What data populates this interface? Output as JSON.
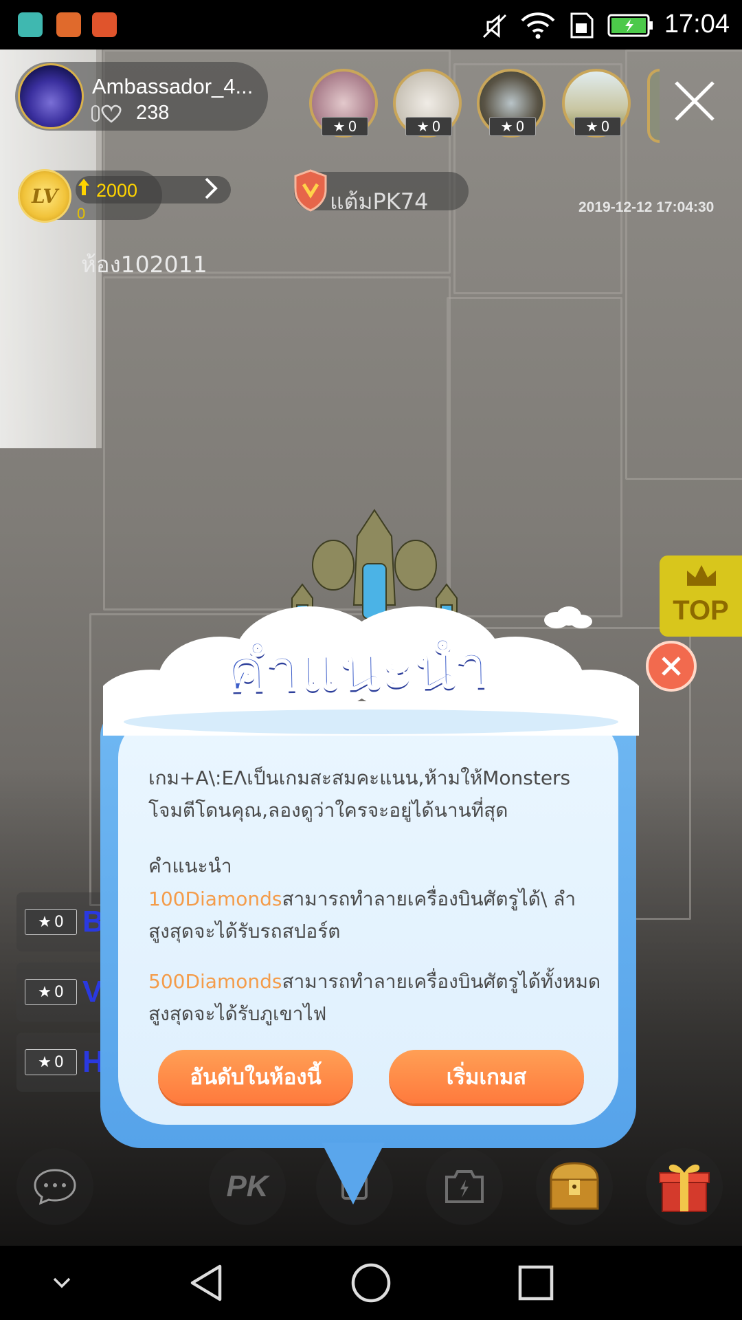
{
  "status_bar": {
    "time": "17:04"
  },
  "host": {
    "name": "Ambassador_4...",
    "likes": "238"
  },
  "viewers": [
    {
      "stars": "0"
    },
    {
      "stars": "0"
    },
    {
      "stars": "0"
    },
    {
      "stars": "0"
    }
  ],
  "level": {
    "badge": "LV",
    "points": "2000",
    "progress": "0"
  },
  "pk": {
    "label": "แต้มPK74"
  },
  "timestamp": "2019-12-12 17:04:30",
  "room": {
    "id": "ห้อง102011"
  },
  "side_list": [
    {
      "stars": "0",
      "letter": "B"
    },
    {
      "stars": "0",
      "letter": "V"
    },
    {
      "stars": "0",
      "letter": "H"
    }
  ],
  "top_tab": {
    "label": "TOP"
  },
  "toolbar": {
    "pk_label": "PK"
  },
  "dialog": {
    "title": "คำแนะนำ",
    "intro_line1": "เกม+A\\:EΛเป็นเกมสะสมคะแนน,ห้ามให้Monsters",
    "intro_line2": "โจมตีโดนคุณ,ลองดูว่าใครจะอยู่ได้นานที่สุด",
    "hint_heading": "คำแนะนำ",
    "tip1_amount": "100Diamonds",
    "tip1_text": "สามารถทำลายเครื่องบินศัตรูได้\\ ลำ",
    "tip1_reward": "สูงสุดจะได้รับรถสปอร์ต",
    "tip2_amount": "500Diamonds",
    "tip2_text": "สามารถทำลายเครื่องบินศัตรูได้ทั้งหมด",
    "tip2_reward": "สูงสุดจะได้รับภูเขาไฟ",
    "ranking_button": "อันดับในห้องนี้",
    "start_button": "เริ่มเกมส"
  },
  "colors": {
    "accent_orange": "#ff8a45",
    "dialog_blue": "#56a3ea",
    "title_blue": "#3d5ec9",
    "top_tab": "#d8c61c"
  }
}
